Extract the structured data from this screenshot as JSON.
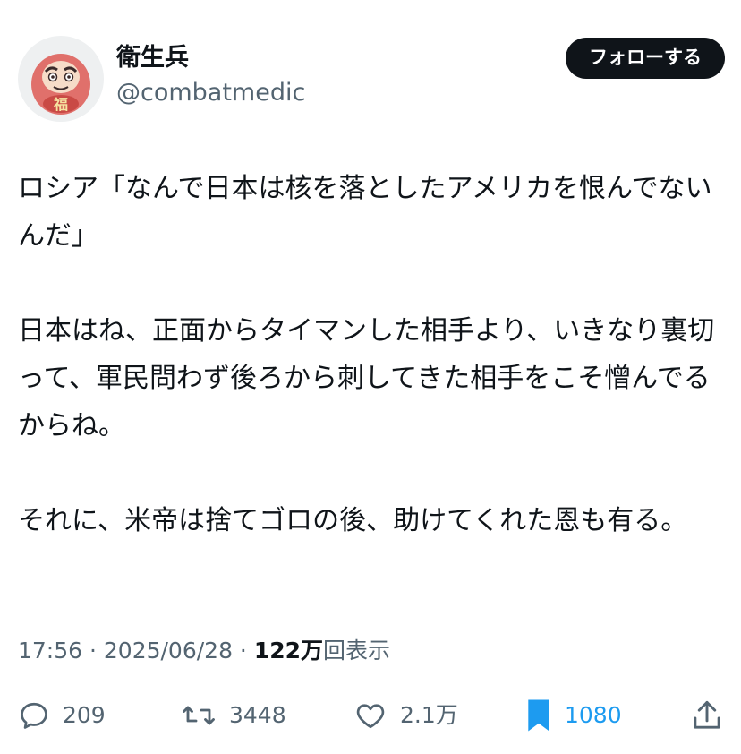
{
  "user": {
    "display_name": "衛生兵",
    "handle": "@combatmedic",
    "avatar_glyph": "福",
    "avatar_icon": "daruma-avatar"
  },
  "follow_label": "フォローする",
  "tweet": {
    "paragraphs": [
      "ロシア「なんで日本は核を落としたアメリカを恨んでないんだ」",
      "日本はね、正面からタイマンした相手より、いきなり裏切って、軍民問わず後ろから刺してきた相手をこそ憎んでるからね。",
      "それに、米帝は捨てゴロの後、助けてくれた恩も有る。"
    ]
  },
  "meta": {
    "time": "17:56",
    "separator": " · ",
    "date": "2025/06/28",
    "views_count": "122万",
    "views_label": "回表示"
  },
  "actions": {
    "replies": "209",
    "reposts": "3448",
    "likes": "2.1万",
    "bookmarks": "1080"
  },
  "colors": {
    "text": "#0f1419",
    "secondary": "#536471",
    "accent": "#1d9bf0",
    "button_bg": "#0f1419"
  }
}
